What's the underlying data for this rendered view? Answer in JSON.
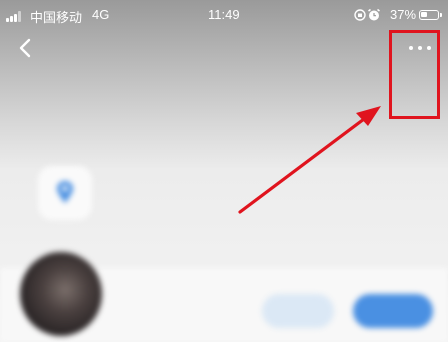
{
  "status_bar": {
    "carrier": "中国移动",
    "network": "4G",
    "time": "11:49",
    "battery_percent": "37%",
    "battery_level": 0.37,
    "icons": [
      "signal-icon",
      "orientation-lock-icon",
      "alarm-icon",
      "battery-icon"
    ]
  },
  "nav": {
    "back_icon": "chevron-left-icon",
    "more_icon": "more-dots-icon"
  },
  "annotation": {
    "highlight_color": "#e0141e",
    "arrow_color": "#e0141e"
  },
  "content": {
    "pin_icon": "location-pin-icon",
    "pin_color": "#4a90e2",
    "secondary_button_label": "",
    "primary_button_label": "",
    "primary_color": "#4a90e2"
  }
}
